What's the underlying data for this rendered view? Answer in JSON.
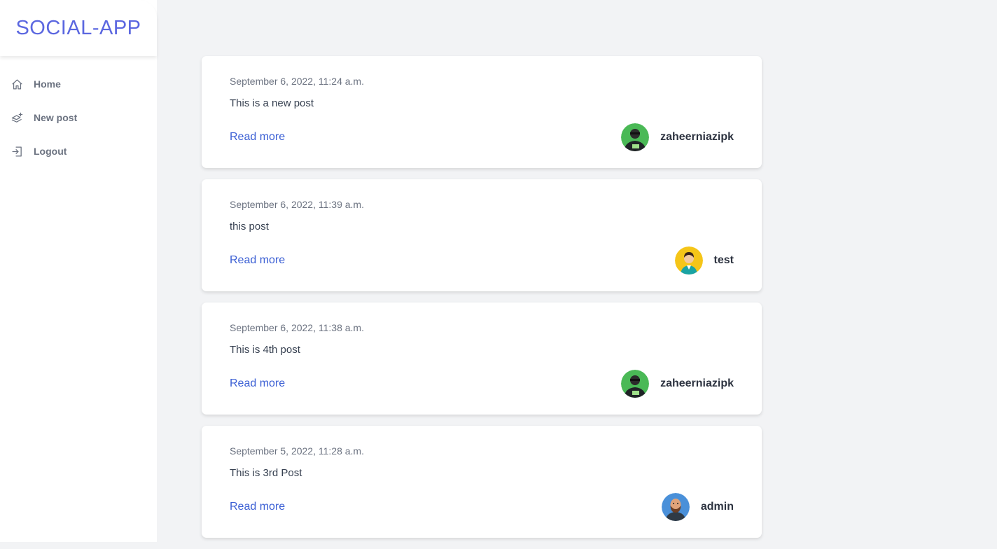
{
  "app": {
    "title": "SOCIAL-APP"
  },
  "sidebar": {
    "items": [
      {
        "label": "Home",
        "icon": "home-icon"
      },
      {
        "label": "New post",
        "icon": "layers-plus-icon"
      },
      {
        "label": "Logout",
        "icon": "logout-icon"
      }
    ]
  },
  "posts": [
    {
      "date": "September 6, 2022, 11:24 a.m.",
      "body": "This is a new post",
      "link": "Read more",
      "author": "zaheerniazipk",
      "avatar": "avatar-man-green"
    },
    {
      "date": "September 6, 2022, 11:39 a.m.",
      "body": "this post",
      "link": "Read more",
      "author": "test",
      "avatar": "avatar-person-yellow"
    },
    {
      "date": "September 6, 2022, 11:38 a.m.",
      "body": "This is 4th post",
      "link": "Read more",
      "author": "zaheerniazipk",
      "avatar": "avatar-man-green"
    },
    {
      "date": "September 5, 2022, 11:28 a.m.",
      "body": "This is 3rd Post",
      "link": "Read more",
      "author": "admin",
      "avatar": "avatar-bearded-blue"
    }
  ],
  "colors": {
    "brand": "#5b67e0",
    "link": "#3b5fd4",
    "background": "#f2f3f5"
  }
}
